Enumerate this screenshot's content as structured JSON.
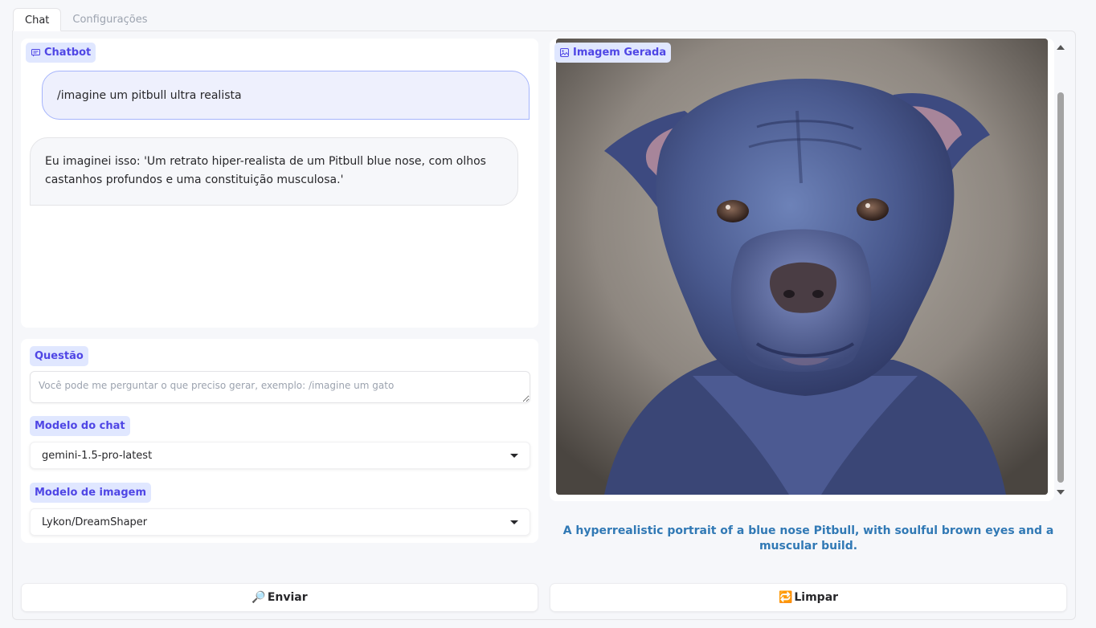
{
  "tabs": [
    {
      "label": "Chat",
      "active": true
    },
    {
      "label": "Configurações",
      "active": false
    }
  ],
  "chatbot": {
    "label": "Chatbot",
    "icon": "chat-icon",
    "messages": [
      {
        "role": "user",
        "text": "/imagine um pitbull ultra realista"
      },
      {
        "role": "bot",
        "text": "Eu imaginei isso: 'Um retrato hiper-realista de um Pitbull blue nose, com olhos castanhos profundos e uma constituição musculosa.'"
      }
    ]
  },
  "question": {
    "label": "Questão",
    "placeholder": "Você pode me perguntar o que preciso gerar, exemplo: /imagine um gato",
    "value": ""
  },
  "chat_model": {
    "label": "Modelo do chat",
    "selected": "gemini-1.5-pro-latest"
  },
  "image_model": {
    "label": "Modelo de imagem",
    "selected": "Lykon/DreamShaper"
  },
  "generated_image": {
    "label": "Imagem Gerada",
    "icon": "image-icon",
    "caption": "A hyperrealistic portrait of a blue nose Pitbull, with soulful brown eyes and a muscular build."
  },
  "buttons": {
    "send": {
      "label": "Enviar",
      "icon": "🔎"
    },
    "clear": {
      "label": "Limpar",
      "icon": "🔁"
    }
  },
  "colors": {
    "accent": "#4f46e5",
    "badge_bg": "#e0e7ff",
    "caption": "#3179b5"
  }
}
